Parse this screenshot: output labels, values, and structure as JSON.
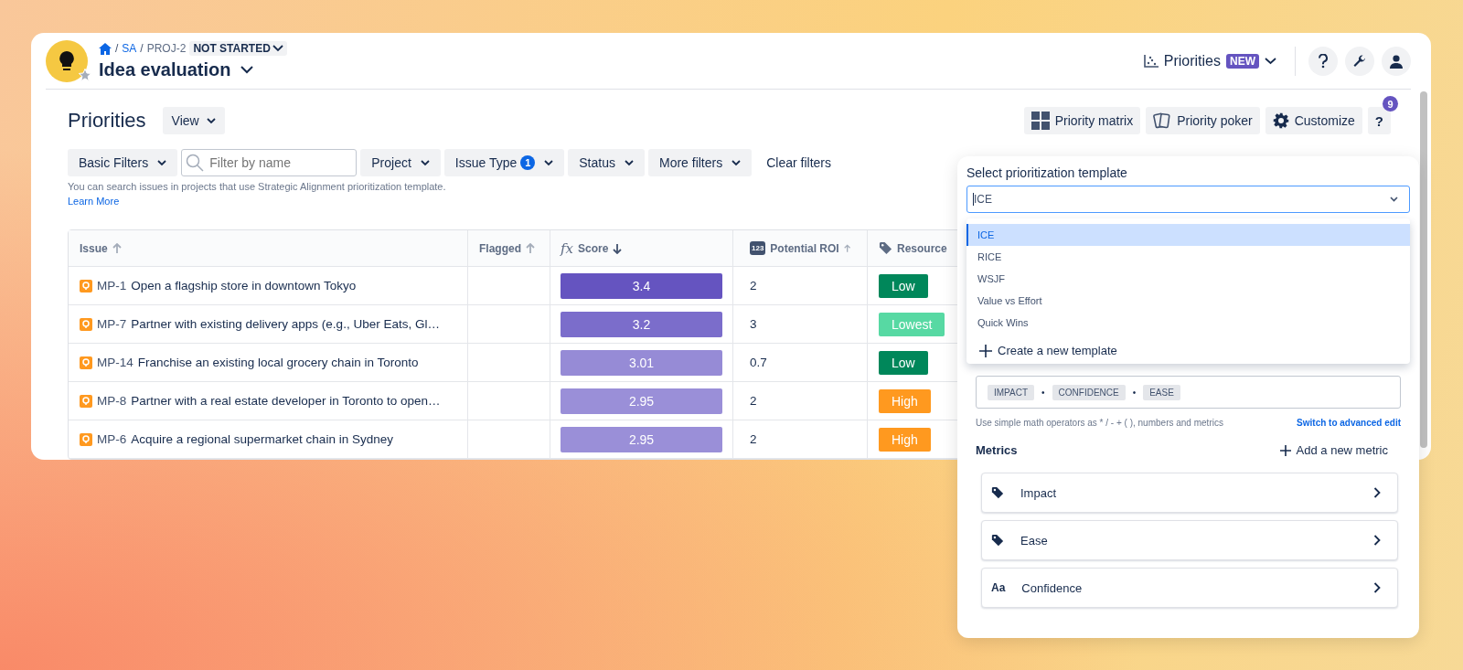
{
  "header": {
    "breadcrumb": [
      {
        "text": "/",
        "kind": "separator"
      },
      {
        "text": "SA",
        "kind": "link"
      },
      {
        "text": "/",
        "kind": "separator"
      },
      {
        "text": "PROJ-2",
        "kind": "plain"
      }
    ],
    "status": "NOT STARTED",
    "title": "Idea evaluation"
  },
  "view_switcher": {
    "label": "Priorities",
    "badge": "NEW"
  },
  "page": {
    "title": "Priorities",
    "view_button": "View"
  },
  "toolbar": [
    {
      "label": "Priority matrix",
      "kind": "matrix"
    },
    {
      "label": "Priority poker",
      "kind": "cards"
    },
    {
      "label": "Customize",
      "kind": "gear"
    }
  ],
  "help": {
    "label": "?",
    "badge": "9"
  },
  "filters": [
    {
      "label": "Basic Filters",
      "kind": "dropdown"
    },
    {
      "placeholder": "Filter by name",
      "kind": "search"
    },
    {
      "label": "Project",
      "kind": "dropdown"
    },
    {
      "label": "Issue Type",
      "badge": "1",
      "kind": "dropdown"
    },
    {
      "label": "Status",
      "kind": "dropdown"
    },
    {
      "label": "More filters",
      "kind": "dropdown"
    }
  ],
  "clear_filters": "Clear filters",
  "hint": "You can search issues in projects that use Strategic Alignment prioritization template.",
  "learn_more": "Learn More",
  "table": {
    "columns": [
      {
        "label": "Issue",
        "kind": "text",
        "ascending": true,
        "sorted": false
      },
      {
        "label": "Flagged",
        "kind": "text",
        "ascending": true,
        "sorted": false
      },
      {
        "label": "Score",
        "kind": "formula",
        "symbol": "fx",
        "ascending": false,
        "sorted": true
      },
      {
        "label": "Potential ROI",
        "kind": "number",
        "symbol": "123",
        "ascending": true,
        "sorted": false
      },
      {
        "label": "Resource",
        "kind": "tag"
      }
    ],
    "rows": [
      {
        "key": "MP-1",
        "summary": "Open a flagship store in downtown Tokyo",
        "score": {
          "value": "3.4",
          "color": "#6554c0"
        },
        "roi": "2",
        "resource": {
          "label": "Low",
          "color": "#00875a"
        }
      },
      {
        "key": "MP-7",
        "summary": "Partner with existing delivery apps (e.g., Uber Eats, Gl…",
        "score": {
          "value": "3.2",
          "color": "#7b6dcb"
        },
        "roi": "3",
        "resource": {
          "label": "Lowest",
          "color": "#57d9a3"
        }
      },
      {
        "key": "MP-14",
        "summary": "Franchise an existing local grocery chain in Toronto",
        "score": {
          "value": "3.01",
          "color": "#968bd6"
        },
        "roi": "0.7",
        "resource": {
          "label": "Low",
          "color": "#00875a"
        }
      },
      {
        "key": "MP-8",
        "summary": "Partner with a real estate developer in Toronto to open…",
        "score": {
          "value": "2.95",
          "color": "#9a8fd8"
        },
        "roi": "2",
        "resource": {
          "label": "High",
          "color": "#ff991f"
        }
      },
      {
        "key": "MP-6",
        "summary": "Acquire a regional supermarket chain in Sydney",
        "score": {
          "value": "2.95",
          "color": "#9a8fd8"
        },
        "roi": "2",
        "resource": {
          "label": "High",
          "color": "#ff991f"
        }
      }
    ]
  },
  "template_panel": {
    "label": "Select prioritization template",
    "value": "ICE",
    "options": [
      {
        "label": "ICE",
        "selected": true
      },
      {
        "label": "RICE",
        "selected": false
      },
      {
        "label": "WSJF",
        "selected": false
      },
      {
        "label": "Value vs Effort",
        "selected": false
      },
      {
        "label": "Quick Wins",
        "selected": false
      }
    ],
    "create_template": "Create a new template",
    "formula": [
      {
        "kind": "metric",
        "text": "IMPACT"
      },
      {
        "kind": "operator",
        "text": "•"
      },
      {
        "kind": "metric",
        "text": "CONFIDENCE"
      },
      {
        "kind": "operator",
        "text": "•"
      },
      {
        "kind": "metric",
        "text": "EASE"
      }
    ],
    "formula_hint": "Use simple math operators as * / - + ( ), numbers and metrics",
    "advanced_edit": "Switch to advanced edit",
    "metrics_title": "Metrics",
    "add_metric": "Add a new metric",
    "metrics": [
      {
        "label": "Impact",
        "kind": "tag"
      },
      {
        "label": "Ease",
        "kind": "tag"
      },
      {
        "label": "Confidence",
        "kind": "text",
        "symbol": "Aa"
      }
    ]
  }
}
